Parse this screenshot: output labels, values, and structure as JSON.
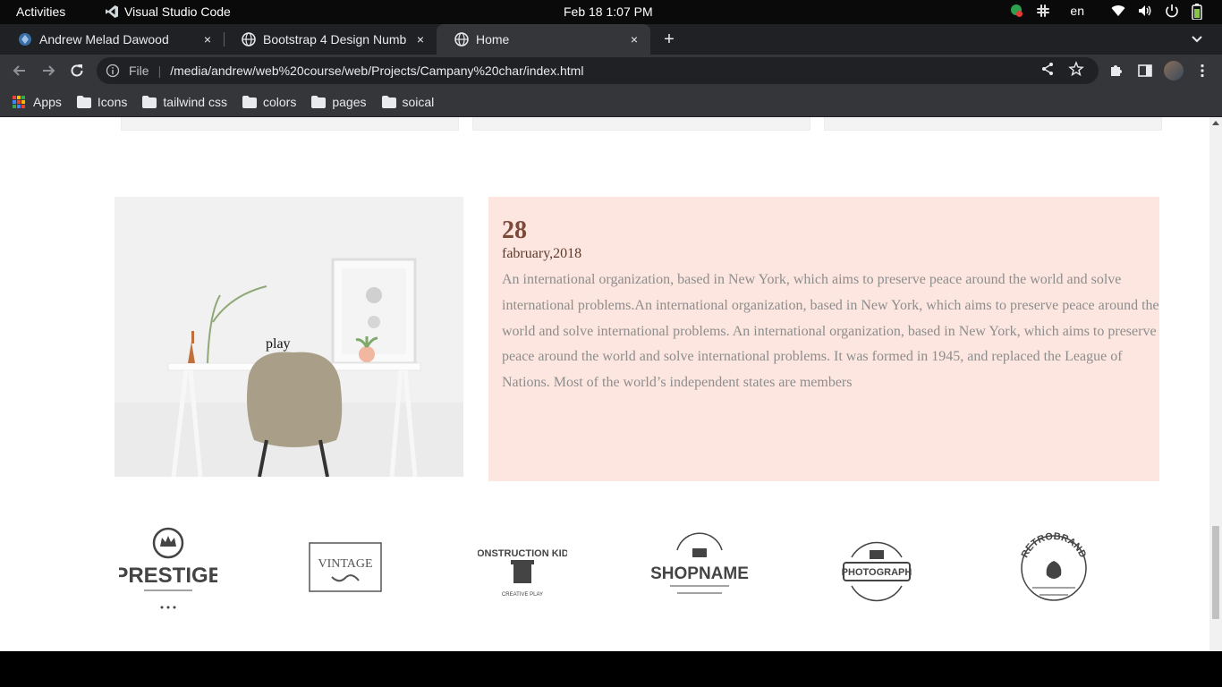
{
  "system_bar": {
    "activities": "Activities",
    "app_name": "Visual Studio Code",
    "clock": "Feb 18  1:07 PM",
    "keyboard_layout": "en"
  },
  "browser": {
    "tabs": [
      {
        "title": "Andrew Melad Dawood",
        "active": false
      },
      {
        "title": "Bootstrap 4 Design Numb",
        "active": false
      },
      {
        "title": "Home",
        "active": true
      }
    ],
    "close_glyph": "×",
    "new_tab_glyph": "+",
    "address": {
      "scheme_label": "File",
      "url": "/media/andrew/web%20course/web/Projects/Campany%20char/index.html"
    },
    "bookmarks": [
      {
        "label": "Apps",
        "icon": "apps-grid-icon"
      },
      {
        "label": "Icons",
        "icon": "folder-icon"
      },
      {
        "label": "tailwind css",
        "icon": "folder-icon"
      },
      {
        "label": "colors",
        "icon": "folder-icon"
      },
      {
        "label": "pages",
        "icon": "folder-icon"
      },
      {
        "label": "soical",
        "icon": "folder-icon"
      }
    ]
  },
  "page": {
    "image_alt": "play",
    "news": {
      "day": "28",
      "month_year": "fabruary,2018",
      "body": "An international organization, based in New York, which aims to preserve peace around the world and solve international problems.An international organization, based in New York, which aims to preserve peace around the world and solve international problems. An international organization, based in New York, which aims to preserve peace around the world and solve international problems. It was formed in 1945, and replaced the League of Nations. Most of the world’s independent states are members"
    },
    "brand_logos": [
      "PRESTIGE",
      "VINTAGE",
      "CONSTRUCTION KIDS",
      "SHOPNAME",
      "PHOTOGRAPH",
      "RETROBRAND"
    ]
  },
  "colors": {
    "news_background": "#fce6df",
    "news_heading": "#7a4a3b",
    "news_text": "#8d8d8d",
    "browser_chrome": "#35363a",
    "tabstrip": "#202124"
  }
}
